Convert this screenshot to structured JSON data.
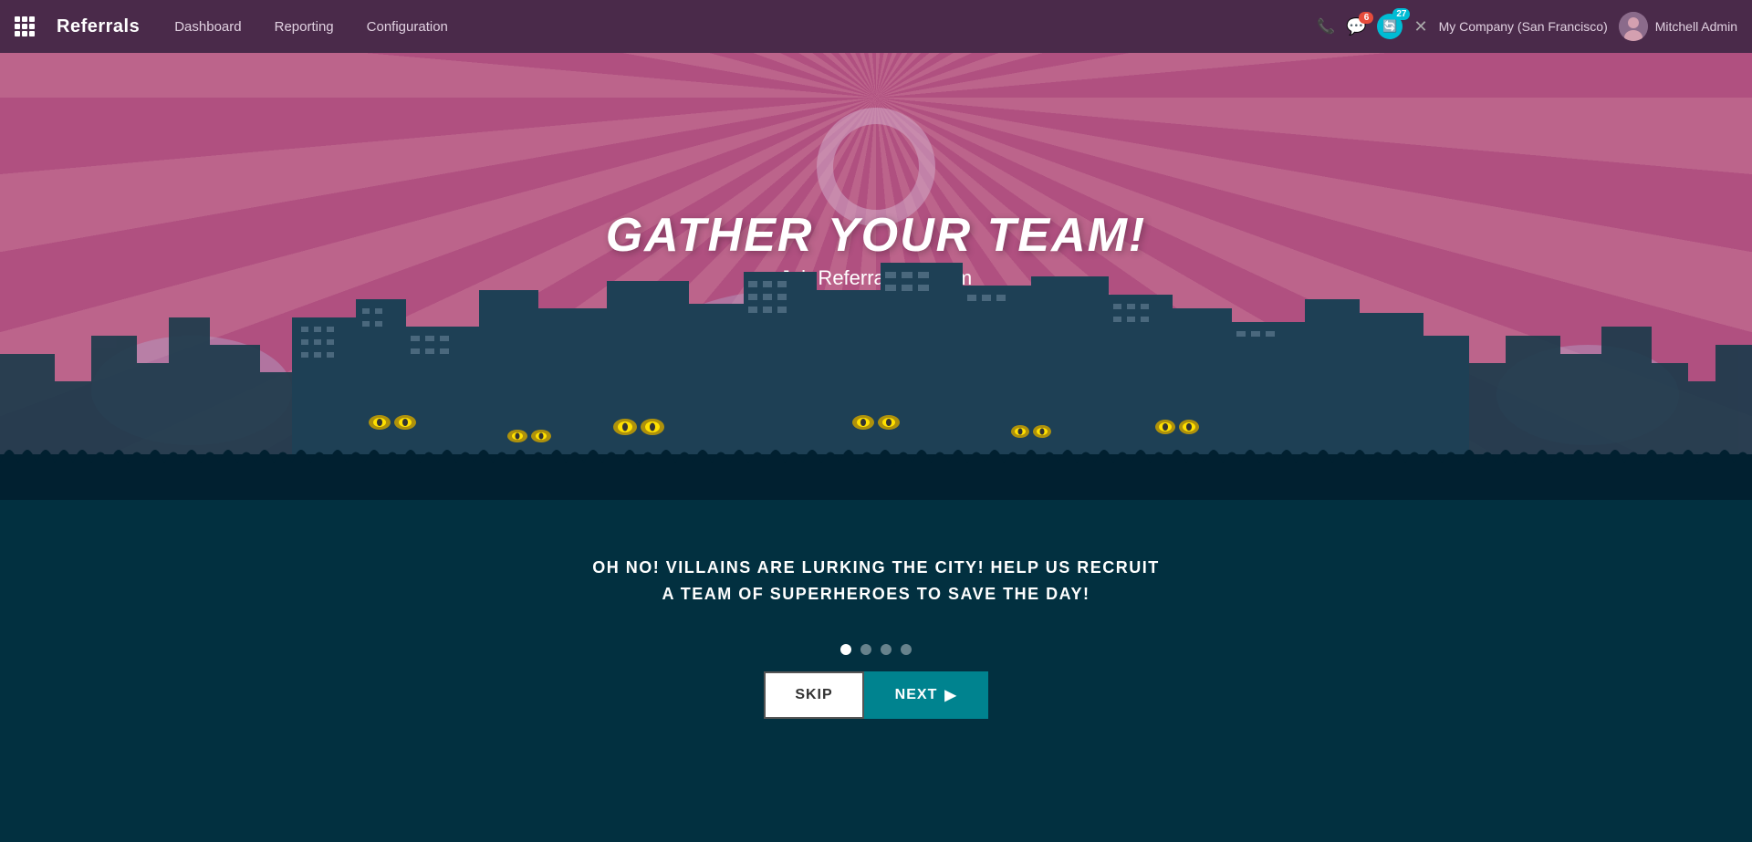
{
  "navbar": {
    "brand": "Referrals",
    "nav_items": [
      {
        "label": "Dashboard",
        "id": "dashboard"
      },
      {
        "label": "Reporting",
        "id": "reporting"
      },
      {
        "label": "Configuration",
        "id": "configuration"
      }
    ],
    "chat_badge": "6",
    "activity_badge": "27",
    "company": "My Company (San Francisco)",
    "user": "Mitchell Admin"
  },
  "hero": {
    "title": "Gather Your Team!",
    "subtitle": "Job Referral Program",
    "tagline_line1": "Oh No! Villains are lurking the city! Help us recruit",
    "tagline_line2": "a team of Superheroes to save the day!"
  },
  "onboarding": {
    "dots_count": 4,
    "active_dot": 0,
    "skip_label": "SKIP",
    "next_label": "NEXT",
    "next_arrow": "▶"
  },
  "icons": {
    "phone": "📞",
    "chat": "💬",
    "activity": "🔄",
    "close": "✕"
  }
}
